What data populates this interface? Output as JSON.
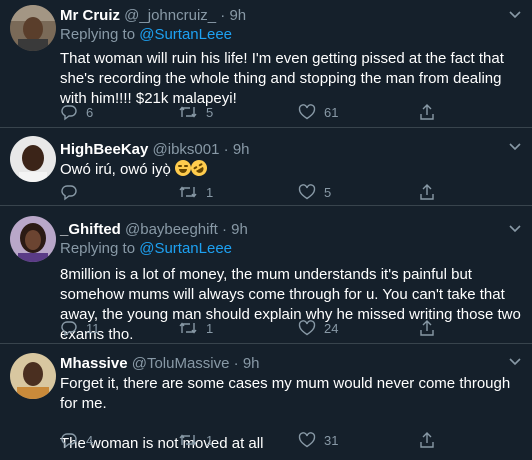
{
  "tweets": [
    {
      "name": "Mr Cruiz",
      "handle": "@_johncruiz_",
      "separator": "·",
      "time": "9h",
      "replying_prefix": "Replying to ",
      "replying_to": "@SurtanLeee",
      "text": "That woman will ruin his life! I'm even getting pissed at the fact that she's recording the whole thing and stopping the man from dealing with him!!!! $21k malapeyi!",
      "replies": "6",
      "retweets": "5",
      "likes": "61"
    },
    {
      "name": "HighBeeKay",
      "handle": "@ibks001",
      "separator": "·",
      "time": "9h",
      "text": "Owó irú, owó iyọ̀",
      "emoji": [
        "face-with-tears-of-joy",
        "rolling-on-floor-laughing"
      ],
      "replies": "",
      "retweets": "1",
      "likes": "5"
    },
    {
      "name": "_Ghifted",
      "handle": "@baybeeghift",
      "separator": "·",
      "time": "9h",
      "replying_prefix": "Replying to ",
      "replying_to": "@SurtanLeee",
      "text": "8million is a lot of money, the mum understands it's painful but somehow mums will always come through for u. You can't take that away, the young man should explain why he missed writing those two exams tho.",
      "replies": "11",
      "retweets": "1",
      "likes": "24"
    },
    {
      "name": "Mhassive",
      "handle": "@ToluMassive",
      "separator": "·",
      "time": "9h",
      "text_line1": "Forget it, there are some cases my mum would never come through for me.",
      "text_line2": "The woman is not moved at all",
      "replies": "4",
      "retweets": "1",
      "likes": "31"
    }
  ],
  "colors": {
    "background": "#15202b",
    "divider": "#38444d",
    "secondary_text": "#8899a6",
    "accent": "#1da1f2"
  },
  "icons": [
    "reply-icon",
    "retweet-icon",
    "like-icon",
    "share-icon",
    "chevron-down-icon"
  ]
}
